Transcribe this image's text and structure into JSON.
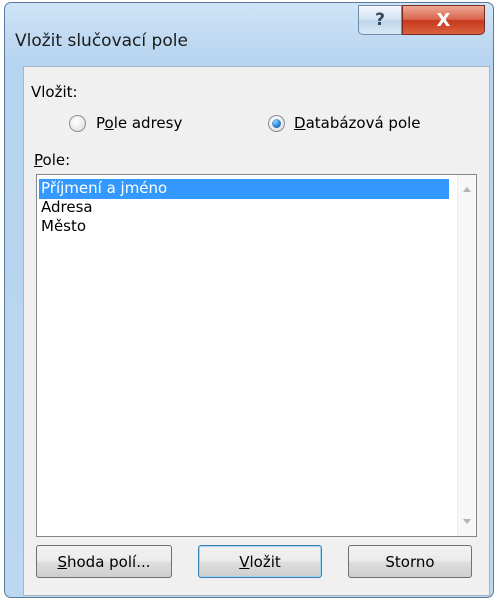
{
  "dialog": {
    "title": "Vložit slučovací pole",
    "help_glyph": "?",
    "close_glyph": "X"
  },
  "insert_group": {
    "label": "Vložit:",
    "options": [
      {
        "label_first": "P",
        "label_ul": "o",
        "label_rest": "le adresy",
        "checked": false
      },
      {
        "label_first": "",
        "label_ul": "D",
        "label_rest": "atabázová pole",
        "checked": true
      }
    ]
  },
  "fields": {
    "label_ul": "P",
    "label_rest": "ole:",
    "items": [
      "Příjmení a jméno",
      "Adresa",
      "Město"
    ],
    "selected_index": 0
  },
  "buttons": {
    "match_ul": "S",
    "match_rest": "hoda polí...",
    "insert_ul": "V",
    "insert_rest": "ložit",
    "cancel": "Storno"
  }
}
